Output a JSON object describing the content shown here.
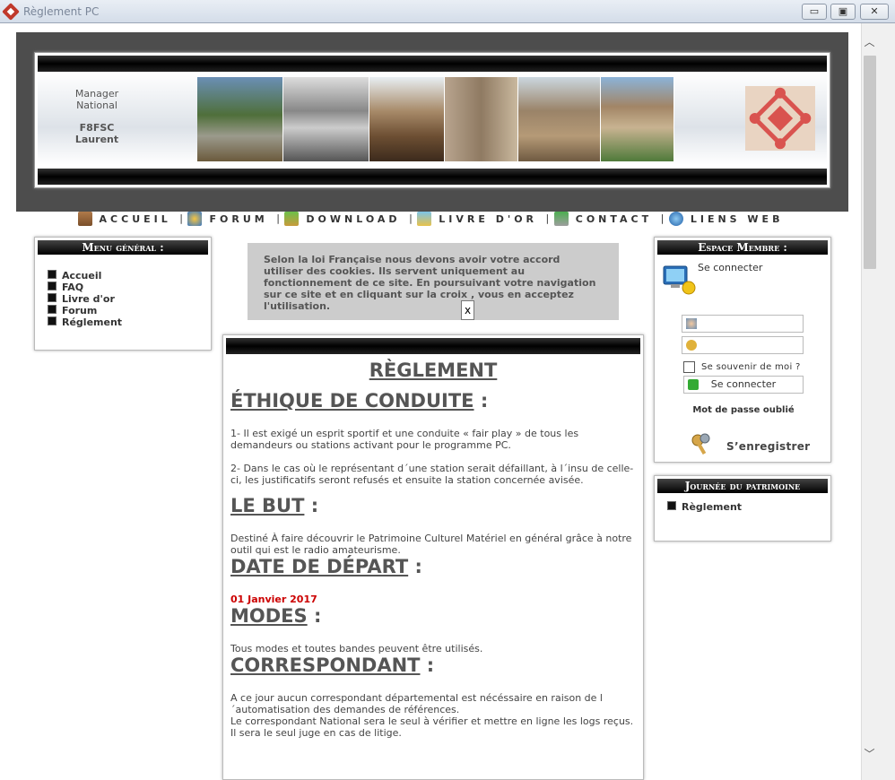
{
  "window": {
    "title": "Règlement PC",
    "minimize": "▭",
    "maximize": "▣",
    "close": "✕"
  },
  "header": {
    "manager_line1": "Manager",
    "manager_line2": "National",
    "callsign": "F8FSC",
    "name": "Laurent"
  },
  "nav": {
    "items": [
      {
        "label": "ACCUEIL",
        "icon": "home-icon"
      },
      {
        "label": "FORUM",
        "icon": "users-icon"
      },
      {
        "label": "DOWNLOAD",
        "icon": "download-icon"
      },
      {
        "label": "LIVRE D'OR",
        "icon": "guestbook-icon"
      },
      {
        "label": "CONTACT",
        "icon": "mail-icon"
      },
      {
        "label": "LIENS WEB",
        "icon": "globe-icon"
      }
    ]
  },
  "left_menu": {
    "title": "Menu général :",
    "items": [
      "Accueil",
      "FAQ",
      "Livre d'or",
      "Forum",
      "Réglement"
    ]
  },
  "cookie_notice": {
    "text": "Selon la loi Française nous devons avoir votre accord utiliser des cookies. Ils servent uniquement au fonctionnement de ce site. En poursuivant votre navigation sur ce site et en cliquant sur la croix , vous en acceptez l'utilisation.",
    "close_label": "x"
  },
  "content": {
    "title": "RÈGLEMENT",
    "sections": {
      "ethique_title": "ÉTHIQUE DE CONDUITE",
      "ethique_p1": "1- Il est exigé un esprit sportif et une conduite « fair play » de tous les demandeurs ou stations activant pour le programme PC.",
      "ethique_p2": "2- Dans le cas où le représentant d´une station serait défaillant, à l´insu de celle-ci, les justificatifs seront refusés et ensuite la station concernée avisée.",
      "but_title": "LE BUT",
      "but_p": "Destiné À faire découvrir le Patrimoine Culturel Matériel en général grâce à notre outil qui est le radio amateurisme.",
      "date_title": "DATE DE DÉPART",
      "date_value": "01 Janvier 2017",
      "modes_title": "MODES",
      "modes_p": "Tous modes et toutes bandes peuvent être utilisés.",
      "corr_title": "CORRESPONDANT",
      "corr_p1": "A ce jour aucun correspondant départemental est nécéssaire en raison de l´automatisation des demandes de références.",
      "corr_p2": "Le correspondant National sera le seul à vérifier et mettre en ligne les logs reçus.",
      "corr_p3": "Il sera le seul juge en cas de litige."
    },
    "colon": ":"
  },
  "member": {
    "title": "Espace Membre :",
    "connect_text": "Se connecter",
    "remember": "Se souvenir de moi ?",
    "connect_button": "Se connecter",
    "forgot": "Mot de passe oublié",
    "register": "S’enregistrer"
  },
  "patrimoine": {
    "title": "Journée du patrimoine",
    "item": "Règlement"
  }
}
